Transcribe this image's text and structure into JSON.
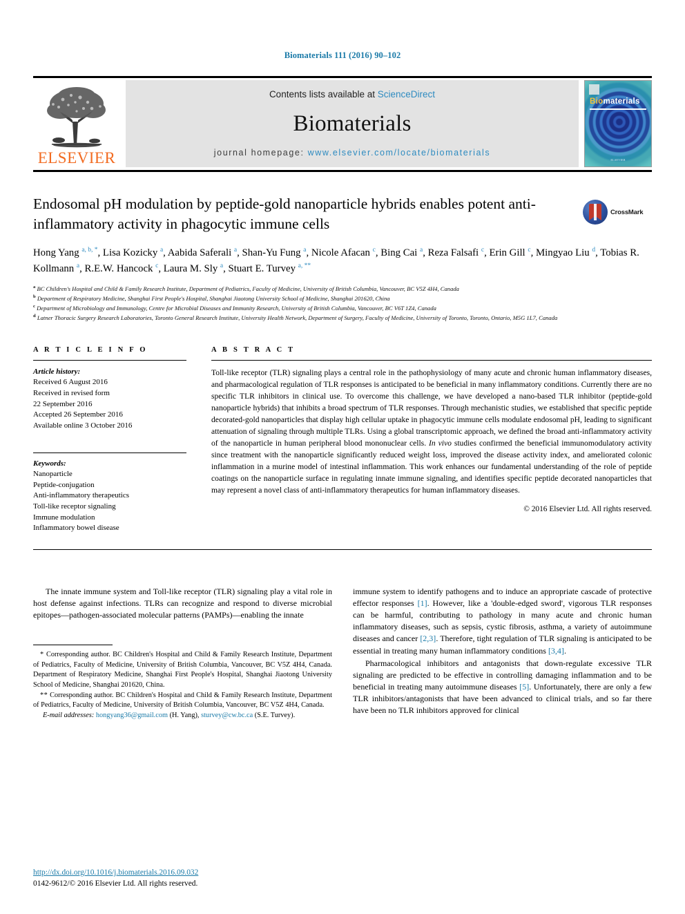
{
  "running_head": "Biomaterials 111 (2016) 90–102",
  "masthead": {
    "contents_prefix": "Contents lists available at ",
    "sciencedirect": "ScienceDirect",
    "journal_name": "Biomaterials",
    "homepage_label": "journal homepage: ",
    "homepage_url": "www.elsevier.com/locate/biomaterials",
    "publisher_name": "ELSEVIER",
    "publisher_logo_icon": "elsevier-tree-icon",
    "cover": {
      "title_part1": "Bio",
      "title_part2": "materials",
      "footer_text": "ELSEVIER"
    }
  },
  "crossmark": {
    "label": "CrossMark",
    "icon": "crossmark-logo-icon"
  },
  "article": {
    "title": "Endosomal pH modulation by peptide-gold nanoparticle hybrids enables potent anti-inflammatory activity in phagocytic immune cells",
    "authors_html": "Hong Yang <sup>a, b, *</sup>, Lisa Kozicky <sup>a</sup>, Aabida Saferali <sup>a</sup>, Shan-Yu Fung <sup>a</sup>, Nicole Afacan <sup>c</sup>, Bing Cai <sup>a</sup>, Reza Falsafi <sup>c</sup>, Erin Gill <sup>c</sup>, Mingyao Liu <sup>d</sup>, Tobias R. Kollmann <sup>a</sup>, R.E.W. Hancock <sup>c</sup>, Laura M. Sly <sup>a</sup>, Stuart E. Turvey <sup>a, **</sup>",
    "affiliations": [
      {
        "marker": "a",
        "text": "BC Children's Hospital and Child & Family Research Institute, Department of Pediatrics, Faculty of Medicine, University of British Columbia, Vancouver, BC V5Z 4H4, Canada"
      },
      {
        "marker": "b",
        "text": "Department of Respiratory Medicine, Shanghai First People's Hospital, Shanghai Jiaotong University School of Medicine, Shanghai 201620, China"
      },
      {
        "marker": "c",
        "text": "Department of Microbiology and Immunology, Centre for Microbial Diseases and Immunity Research, University of British Columbia, Vancouver, BC V6T 1Z4, Canada"
      },
      {
        "marker": "d",
        "text": "Latner Thoracic Surgery Research Laboratories, Toronto General Research Institute, University Health Network, Department of Surgery, Faculty of Medicine, University of Toronto, Toronto, Ontario, M5G 1L7, Canada"
      }
    ]
  },
  "article_info": {
    "heading": "A R T I C L E  I N F O",
    "history_label": "Article history:",
    "history": [
      "Received 6 August 2016",
      "Received in revised form",
      "22 September 2016",
      "Accepted 26 September 2016",
      "Available online 3 October 2016"
    ],
    "keywords_label": "Keywords:",
    "keywords": [
      "Nanoparticle",
      "Peptide-conjugation",
      "Anti-inflammatory therapeutics",
      "Toll-like receptor signaling",
      "Immune modulation",
      "Inflammatory bowel disease"
    ]
  },
  "abstract": {
    "heading": "A B S T R A C T",
    "text_html": "Toll-like receptor (TLR) signaling plays a central role in the pathophysiology of many acute and chronic human inflammatory diseases, and pharmacological regulation of TLR responses is anticipated to be beneficial in many inflammatory conditions. Currently there are no specific TLR inhibitors in clinical use. To overcome this challenge, we have developed a nano-based TLR inhibitor (peptide-gold nanoparticle hybrids) that inhibits a broad spectrum of TLR responses. Through mechanistic studies, we established that specific peptide decorated-gold nanoparticles that display high cellular uptake in phagocytic immune cells modulate endosomal pH, leading to significant attenuation of signaling through multiple TLRs. Using a global transcriptomic approach, we defined the broad anti-inflammatory activity of the nanoparticle in human peripheral blood mononuclear cells. <i>In vivo</i> studies confirmed the beneficial immunomodulatory activity since treatment with the nanoparticle significantly reduced weight loss, improved the disease activity index, and ameliorated colonic inflammation in a murine model of intestinal inflammation. This work enhances our fundamental understanding of the role of peptide coatings on the nanoparticle surface in regulating innate immune signaling, and identifies specific peptide decorated nanoparticles that may represent a novel class of anti-inflammatory therapeutics for human inflammatory diseases.",
    "copyright": "© 2016 Elsevier Ltd. All rights reserved."
  },
  "body": {
    "left_paragraph_html": "The innate immune system and Toll-like receptor (TLR) signaling play a vital role in host defense against infections. TLRs can recognize and respond to diverse microbial epitopes—pathogen-associated molecular patterns (PAMPs)—enabling the innate",
    "right_paragraph1_html": "immune system to identify pathogens and to induce an appropriate cascade of protective effector responses <span class=\"ref\">[1]</span>. However, like a 'double-edged sword', vigorous TLR responses can be harmful, contributing to pathology in many acute and chronic human inflammatory diseases, such as sepsis, cystic fibrosis, asthma, a variety of autoimmune diseases and cancer <span class=\"ref\">[2,3]</span>. Therefore, tight regulation of TLR signaling is anticipated to be essential in treating many human inflammatory conditions <span class=\"ref\">[3,4]</span>.",
    "right_paragraph2_html": "Pharmacological inhibitors and antagonists that down-regulate excessive TLR signaling are predicted to be effective in controlling damaging inflammation and to be beneficial in treating many autoimmune diseases <span class=\"ref\">[5]</span>. Unfortunately, there are only a few TLR inhibitors/antagonists that have been advanced to clinical trials, and so far there have been no TLR inhibitors approved for clinical"
  },
  "footnotes": {
    "note1_html": "<span class=\"star\">*</span> Corresponding author. BC Children's Hospital and Child &amp; Family Research Institute, Department of Pediatrics, Faculty of Medicine, University of British Columbia, Vancouver, BC V5Z 4H4, Canada. Department of Respiratory Medicine, Shanghai First People's Hospital, Shanghai Jiaotong University School of Medicine, Shanghai 201620, China.",
    "note2_html": "<span class=\"star\">**</span> Corresponding author. BC Children's Hospital and Child &amp; Family Research Institute, Department of Pediatrics, Faculty of Medicine, University of British Columbia, Vancouver, BC V5Z 4H4, Canada.",
    "email_label": "E-mail addresses:",
    "email1": "hongyang36@gmail.com",
    "email1_owner": "(H. Yang)",
    "email2": "sturvey@cw.bc.ca",
    "email2_owner": "(S.E. Turvey)."
  },
  "footer": {
    "doi": "http://dx.doi.org/10.1016/j.biomaterials.2016.09.032",
    "issn_line": "0142-9612/© 2016 Elsevier Ltd. All rights reserved."
  },
  "colors": {
    "link": "#1a7aa8",
    "masthead_link": "#2e8bc0",
    "elsevier_orange": "#f26b21",
    "masthead_bg": "#e3e3e3"
  }
}
